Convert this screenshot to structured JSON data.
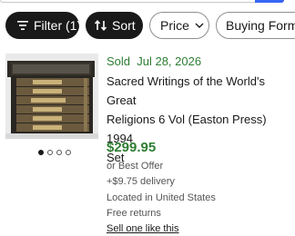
{
  "filters": [
    {
      "label": "Filter (1)",
      "icon": "filter-lines-icon",
      "style": "dark"
    },
    {
      "label": "Sort",
      "icon": "sort-arrows-icon",
      "style": "dark"
    },
    {
      "label": "Price",
      "icon": "chevron-down-icon",
      "style": "light"
    },
    {
      "label": "Buying Forma",
      "style": "light"
    }
  ],
  "listing": {
    "status": "Sold  Jul 28, 2026",
    "title_lines": [
      "Sacred Writings of the World's Great",
      "Religions 6 Vol (Easton Press) 1994",
      "Set"
    ],
    "image_pages": 4,
    "active_page": 1,
    "price": "$299.95",
    "best_offer": "or Best Offer",
    "delivery": "+$9.75 delivery",
    "location": "Located in United States",
    "returns": "Free returns",
    "sell_link": "Sell one like this"
  },
  "colors": {
    "sold_green": "#2e7d32",
    "chip_dark": "#191919",
    "search_blue": "#3665f3"
  }
}
